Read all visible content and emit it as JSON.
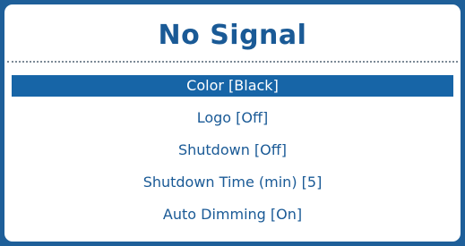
{
  "header": {
    "title": "No Signal"
  },
  "menu": {
    "items": [
      {
        "label": "Color [Black]",
        "selected": true
      },
      {
        "label": "Logo [Off]",
        "selected": false
      },
      {
        "label": "Shutdown [Off]",
        "selected": false
      },
      {
        "label": "Shutdown Time (min) [5]",
        "selected": false
      },
      {
        "label": "Auto Dimming [On]",
        "selected": false
      }
    ]
  },
  "colors": {
    "frame": "#1e5f99",
    "accent": "#1765a7",
    "text": "#1a5a96"
  }
}
